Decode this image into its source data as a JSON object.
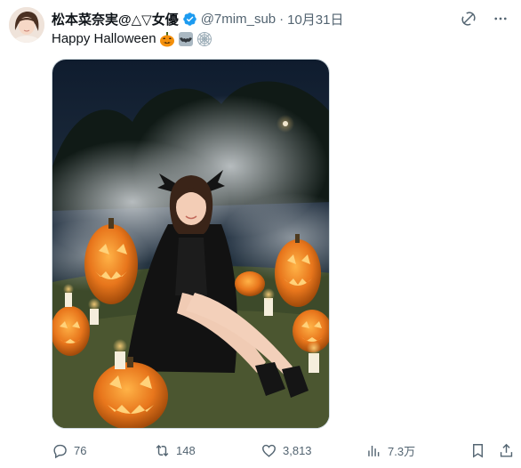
{
  "author": {
    "display_name": "松本菜奈実@△▽女優",
    "handle": "@7mim_sub",
    "separator": "·",
    "date": "10月31日",
    "verified_icon": "verified-badge-icon"
  },
  "header_icons": [
    "grok-icon",
    "more-icon"
  ],
  "tweet": {
    "text": "Happy Halloween",
    "emojis": [
      "jack-o-lantern",
      "bat",
      "spider-web"
    ]
  },
  "media": {
    "type": "photo",
    "icon": "photo-halloween"
  },
  "actions": {
    "reply_count": "76",
    "retweet_count": "148",
    "like_count": "3,813",
    "views_count": "7.3万"
  },
  "colors": {
    "text": "#0f1419",
    "secondary": "#536471",
    "verified": "#1d9bf0"
  }
}
